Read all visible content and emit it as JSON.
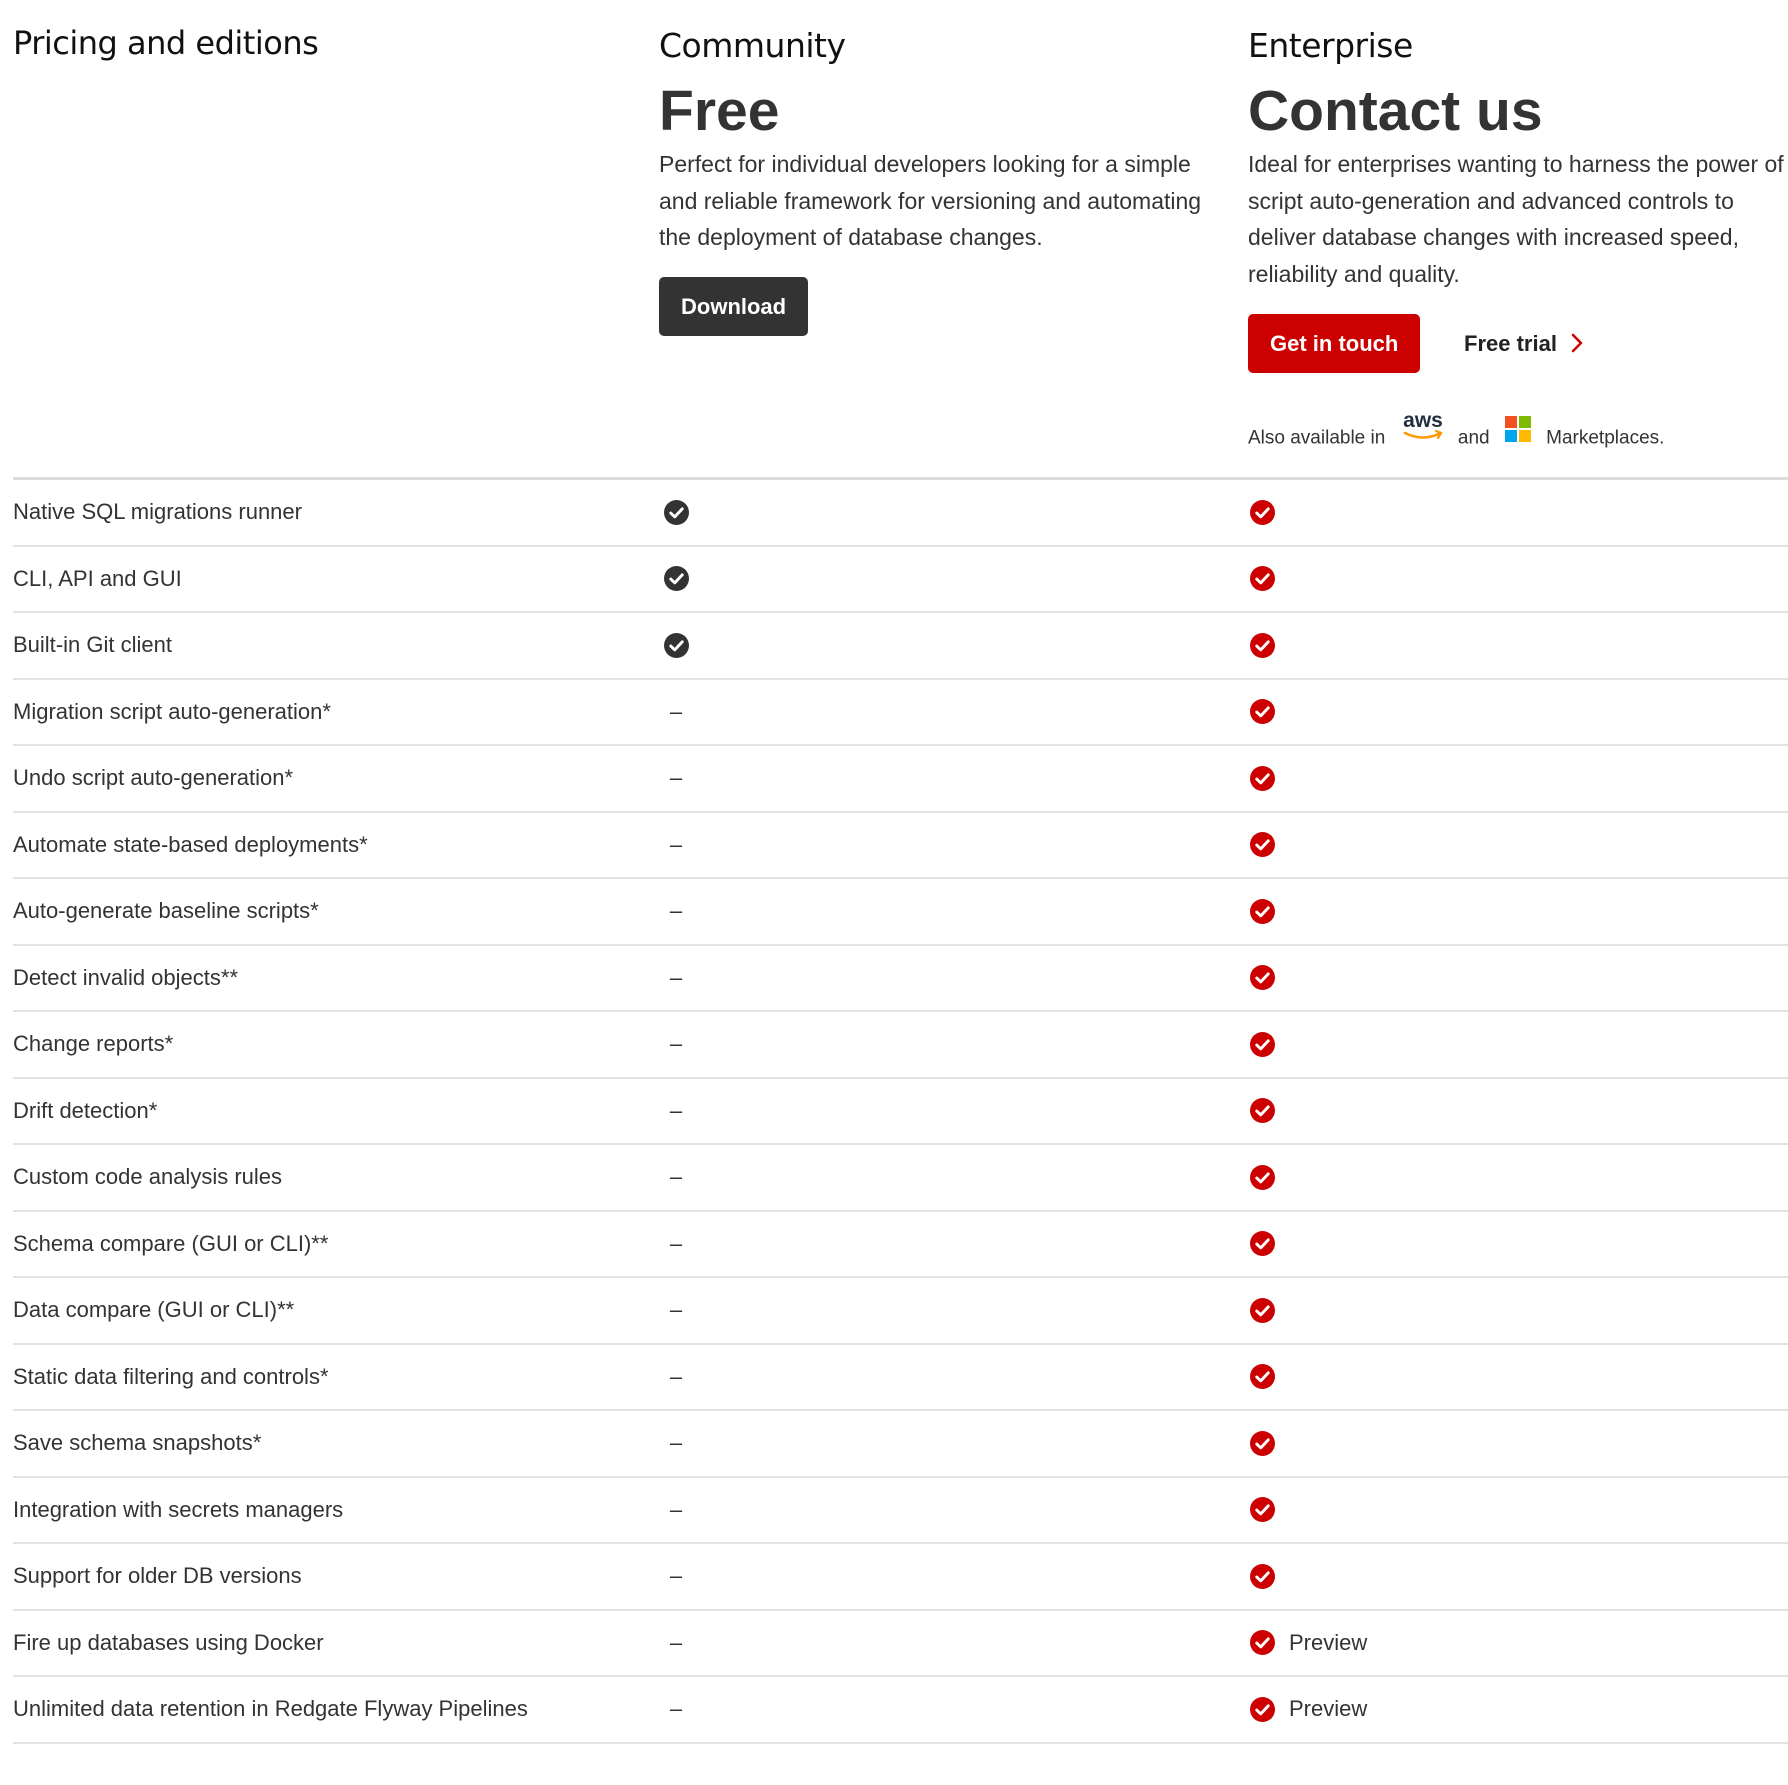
{
  "header": {
    "title": "Pricing and editions"
  },
  "community": {
    "name": "Community",
    "price": "Free",
    "description_lines": [
      "Perfect for individual developers looking for a simple",
      "and reliable framework for versioning and automating",
      "the deployment of database changes."
    ],
    "download_label": "Download"
  },
  "enterprise": {
    "name": "Enterprise",
    "price": "Contact us",
    "description_lines": [
      "Ideal for enterprises wanting to harness the power of",
      "script auto-generation and advanced controls to",
      "deliver database changes with increased speed,",
      "reliability and quality."
    ],
    "get_in_touch_label": "Get in touch",
    "free_trial_label": "Free trial",
    "marketplace": {
      "prefix": "Also available in",
      "aws_logo_text": "aws",
      "and": "and",
      "suffix": "Marketplaces."
    }
  },
  "colors": {
    "accent_red": "#cc0000",
    "dark_button": "#333333",
    "community_check": "#333333",
    "enterprise_check": "#cc0000"
  },
  "features": [
    {
      "label": "Native SQL migrations runner",
      "community": "check",
      "enterprise": "check",
      "enterprise_note": ""
    },
    {
      "label": "CLI, API and GUI",
      "community": "check",
      "enterprise": "check",
      "enterprise_note": ""
    },
    {
      "label": "Built-in Git client",
      "community": "check",
      "enterprise": "check",
      "enterprise_note": ""
    },
    {
      "label": "Migration script auto-generation*",
      "community": "dash",
      "enterprise": "check",
      "enterprise_note": ""
    },
    {
      "label": "Undo script auto-generation*",
      "community": "dash",
      "enterprise": "check",
      "enterprise_note": ""
    },
    {
      "label": "Automate state-based deployments*",
      "community": "dash",
      "enterprise": "check",
      "enterprise_note": ""
    },
    {
      "label": "Auto-generate baseline scripts*",
      "community": "dash",
      "enterprise": "check",
      "enterprise_note": ""
    },
    {
      "label": "Detect invalid objects**",
      "community": "dash",
      "enterprise": "check",
      "enterprise_note": ""
    },
    {
      "label": "Change reports*",
      "community": "dash",
      "enterprise": "check",
      "enterprise_note": ""
    },
    {
      "label": "Drift detection*",
      "community": "dash",
      "enterprise": "check",
      "enterprise_note": ""
    },
    {
      "label": "Custom code analysis rules",
      "community": "dash",
      "enterprise": "check",
      "enterprise_note": ""
    },
    {
      "label": "Schema compare (GUI or CLI)**",
      "community": "dash",
      "enterprise": "check",
      "enterprise_note": ""
    },
    {
      "label": "Data compare (GUI or CLI)**",
      "community": "dash",
      "enterprise": "check",
      "enterprise_note": ""
    },
    {
      "label": "Static data filtering and controls*",
      "community": "dash",
      "enterprise": "check",
      "enterprise_note": ""
    },
    {
      "label": "Save schema snapshots*",
      "community": "dash",
      "enterprise": "check",
      "enterprise_note": ""
    },
    {
      "label": "Integration with secrets managers",
      "community": "dash",
      "enterprise": "check",
      "enterprise_note": ""
    },
    {
      "label": "Support for older DB versions",
      "community": "dash",
      "enterprise": "check",
      "enterprise_note": ""
    },
    {
      "label": "Fire up databases using Docker",
      "community": "dash",
      "enterprise": "check",
      "enterprise_note": "Preview"
    },
    {
      "label": "Unlimited data retention in Redgate Flyway Pipelines",
      "community": "dash",
      "enterprise": "check",
      "enterprise_note": "Preview"
    }
  ],
  "dash_symbol": "–"
}
